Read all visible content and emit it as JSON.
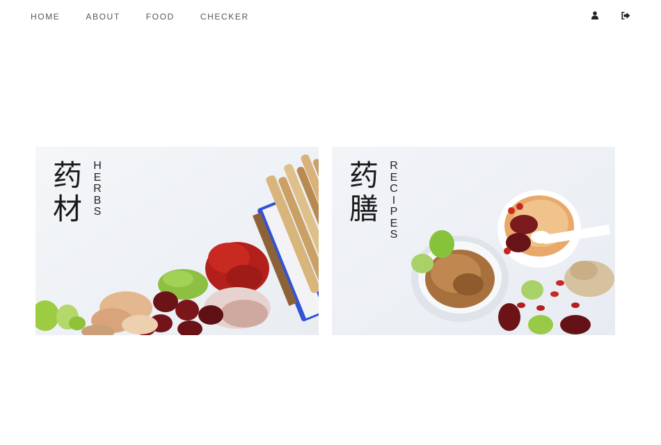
{
  "nav": {
    "links": [
      "HOME",
      "ABOUT",
      "FOOD",
      "CHECKER"
    ],
    "icons": [
      "user-icon",
      "logout-icon"
    ]
  },
  "cards": [
    {
      "cn": [
        "药",
        "材"
      ],
      "en": "HERBS"
    },
    {
      "cn": [
        "药",
        "膳"
      ],
      "en": "RECIPES"
    }
  ]
}
